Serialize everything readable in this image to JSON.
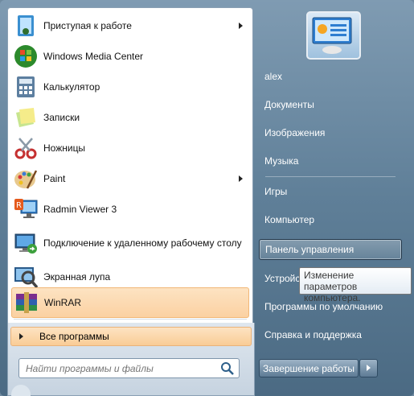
{
  "left_items": [
    {
      "label": "Приступая к работе",
      "icon": "getting-started-icon",
      "submenu": true
    },
    {
      "label": "Windows Media Center",
      "icon": "media-center-icon",
      "submenu": false
    },
    {
      "label": "Калькулятор",
      "icon": "calculator-icon",
      "submenu": false
    },
    {
      "label": "Записки",
      "icon": "sticky-notes-icon",
      "submenu": false
    },
    {
      "label": "Ножницы",
      "icon": "scissors-icon",
      "submenu": false
    },
    {
      "label": "Paint",
      "icon": "paint-icon",
      "submenu": true
    },
    {
      "label": "Radmin Viewer 3",
      "icon": "radmin-icon",
      "submenu": false
    },
    {
      "label": "Подключение к удаленному рабочему столу",
      "icon": "remote-desktop-icon",
      "submenu": false
    },
    {
      "label": "Экранная лупа",
      "icon": "magnifier-icon",
      "submenu": false
    },
    {
      "label": "WinRAR",
      "icon": "winrar-icon",
      "submenu": false
    }
  ],
  "all_programs": "Все программы",
  "search_placeholder": "Найти программы и файлы",
  "right_items": [
    {
      "label": "alex"
    },
    {
      "label": "Документы"
    },
    {
      "label": "Изображения"
    },
    {
      "label": "Музыка"
    },
    {
      "label": "Игры"
    },
    {
      "label": "Компьютер"
    },
    {
      "label": "Панель управления"
    },
    {
      "label": "Устройства и принтеры"
    },
    {
      "label": "Программы по умолчанию"
    },
    {
      "label": "Справка и поддержка"
    }
  ],
  "shutdown_label": "Завершение работы",
  "tooltip_text": "Изменение параметров компьютера."
}
